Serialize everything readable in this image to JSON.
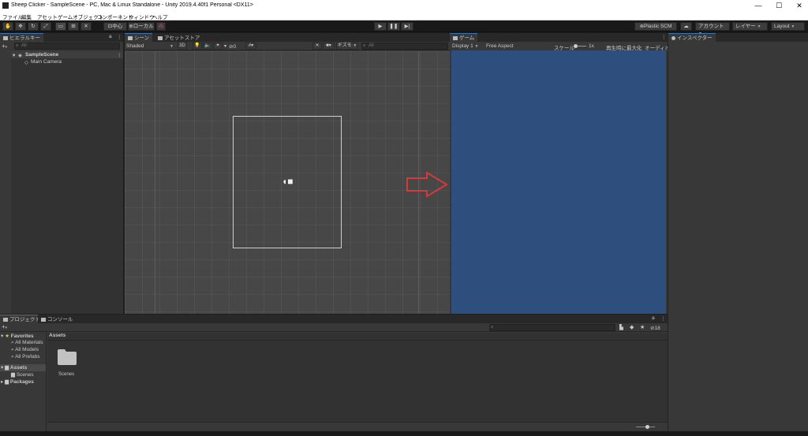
{
  "window": {
    "title": "Sheep Clicker - SampleScene - PC, Mac & Linux Standalone - Unity 2019.4.40f1 Personal <DX11>",
    "minimize": "—",
    "maximize": "☐",
    "close": "✕"
  },
  "menu": [
    "ファイル",
    "編集",
    "アセット",
    "ゲームオブジェクト",
    "コンポーネント",
    "ウィンドウ",
    "ヘルプ"
  ],
  "toolbar": {
    "tools": [
      "hand-tool",
      "move-tool",
      "rotate-tool",
      "scale-tool",
      "rect-tool",
      "transform-tool",
      "custom-tool"
    ],
    "pivot_label": "中心",
    "space_label": "ローカル",
    "plastic_label": "Plastic SCM",
    "account_label": "アカウント",
    "layers_label": "レイヤー",
    "layout_label": "Layout"
  },
  "hierarchy": {
    "tab": "ヒエラルキー",
    "add": "+",
    "search_placeholder": "All",
    "scene": "SampleScene",
    "objects": [
      "Main Camera"
    ]
  },
  "scene_view": {
    "tab_scene": "シーン",
    "tab_store": "アセットストア",
    "shading": "Shaded",
    "mode_2d": "3D",
    "hidden_count": "0",
    "gizmos": "ギズモ",
    "search_placeholder": "All"
  },
  "game_view": {
    "tab": "ゲーム",
    "display": "Display 1",
    "aspect": "Free Aspect",
    "scale_label": "スケール",
    "scale_value": "1x",
    "maximize_on_play": "再生時に最大化",
    "audio": "オーディオ",
    "background_color": "#2e4e7e"
  },
  "inspector": {
    "tab": "インスペクター"
  },
  "project": {
    "tab_project": "プロジェクト",
    "tab_console": "コンソール",
    "add": "+",
    "favorites_label": "Favorites",
    "favorites": [
      "All Materials",
      "All Models",
      "All Prefabs"
    ],
    "assets_label": "Assets",
    "asset_children": [
      "Scenes"
    ],
    "packages_label": "Packages",
    "breadcrumb": "Assets",
    "folders": [
      "Scenes"
    ],
    "hidden_count": "18"
  },
  "colors": {
    "accent_blue": "#3a72b0",
    "arrow_red": "#d43a3a"
  }
}
